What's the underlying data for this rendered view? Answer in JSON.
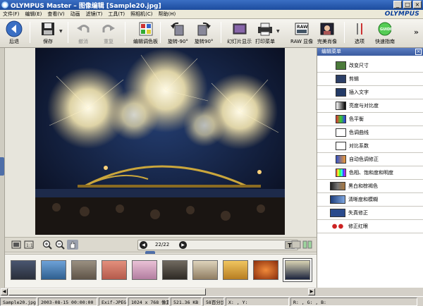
{
  "window": {
    "app_name": "OLYMPUS Master",
    "separator": "–",
    "mode": "图像编辑",
    "filename": "[Sample20.jpg]",
    "btn_min": "_",
    "btn_max": "□",
    "btn_close": "×"
  },
  "brand": "OLYMPUS",
  "menu": [
    {
      "label": "文件(F)"
    },
    {
      "label": "编辑(E)"
    },
    {
      "label": "查看(V)"
    },
    {
      "label": "动画"
    },
    {
      "label": "滤镜(T)"
    },
    {
      "label": "工具(T)"
    },
    {
      "label": "照相机(C)"
    },
    {
      "label": "帮助(H)"
    }
  ],
  "toolbar": {
    "back": "后退",
    "save": "保存",
    "undo": "撤消",
    "redo": "重复",
    "edit_color": "编辑调色板",
    "rotate_left": "旋转-90°",
    "rotate_right": "旋转90°",
    "slideshow": "幻灯片显示",
    "print_menu": "打印菜单",
    "raw": "RAW 显像",
    "perfect": "完美肖像",
    "options": "选项",
    "quick_guide": "快速指南",
    "more": "»"
  },
  "nav": {
    "page": "22/22",
    "prev": "◀",
    "next": "▶",
    "text_btn": "T"
  },
  "panel": {
    "title": "编辑菜单",
    "close": "×",
    "items": [
      {
        "label": "改变尺寸"
      },
      {
        "label": "剪辑"
      },
      {
        "label": "插入文字"
      },
      {
        "label": "亮度与对比度"
      },
      {
        "label": "色平衡"
      },
      {
        "label": "色调曲线"
      },
      {
        "label": "对比系数"
      },
      {
        "label": "自动色调修正"
      },
      {
        "label": "色相、饱和度和明度"
      },
      {
        "label": "黑白和棕褐色"
      },
      {
        "label": "清晰度和模糊"
      },
      {
        "label": "失真修正"
      },
      {
        "label": "修正红眼"
      }
    ]
  },
  "status": {
    "file": "Sample20.jpg",
    "datetime": "2003-08-15 00:00:00",
    "format": "Exif-JPEG",
    "size": "1024 x 768 像素",
    "filesize": "521.36 KB",
    "zoom": "58百分比",
    "xy": "X: , Y:",
    "rgb": "R: , G: , B:"
  },
  "colors": {
    "accent": "#3b5c9f",
    "title_bar": "#1d4c9e"
  }
}
